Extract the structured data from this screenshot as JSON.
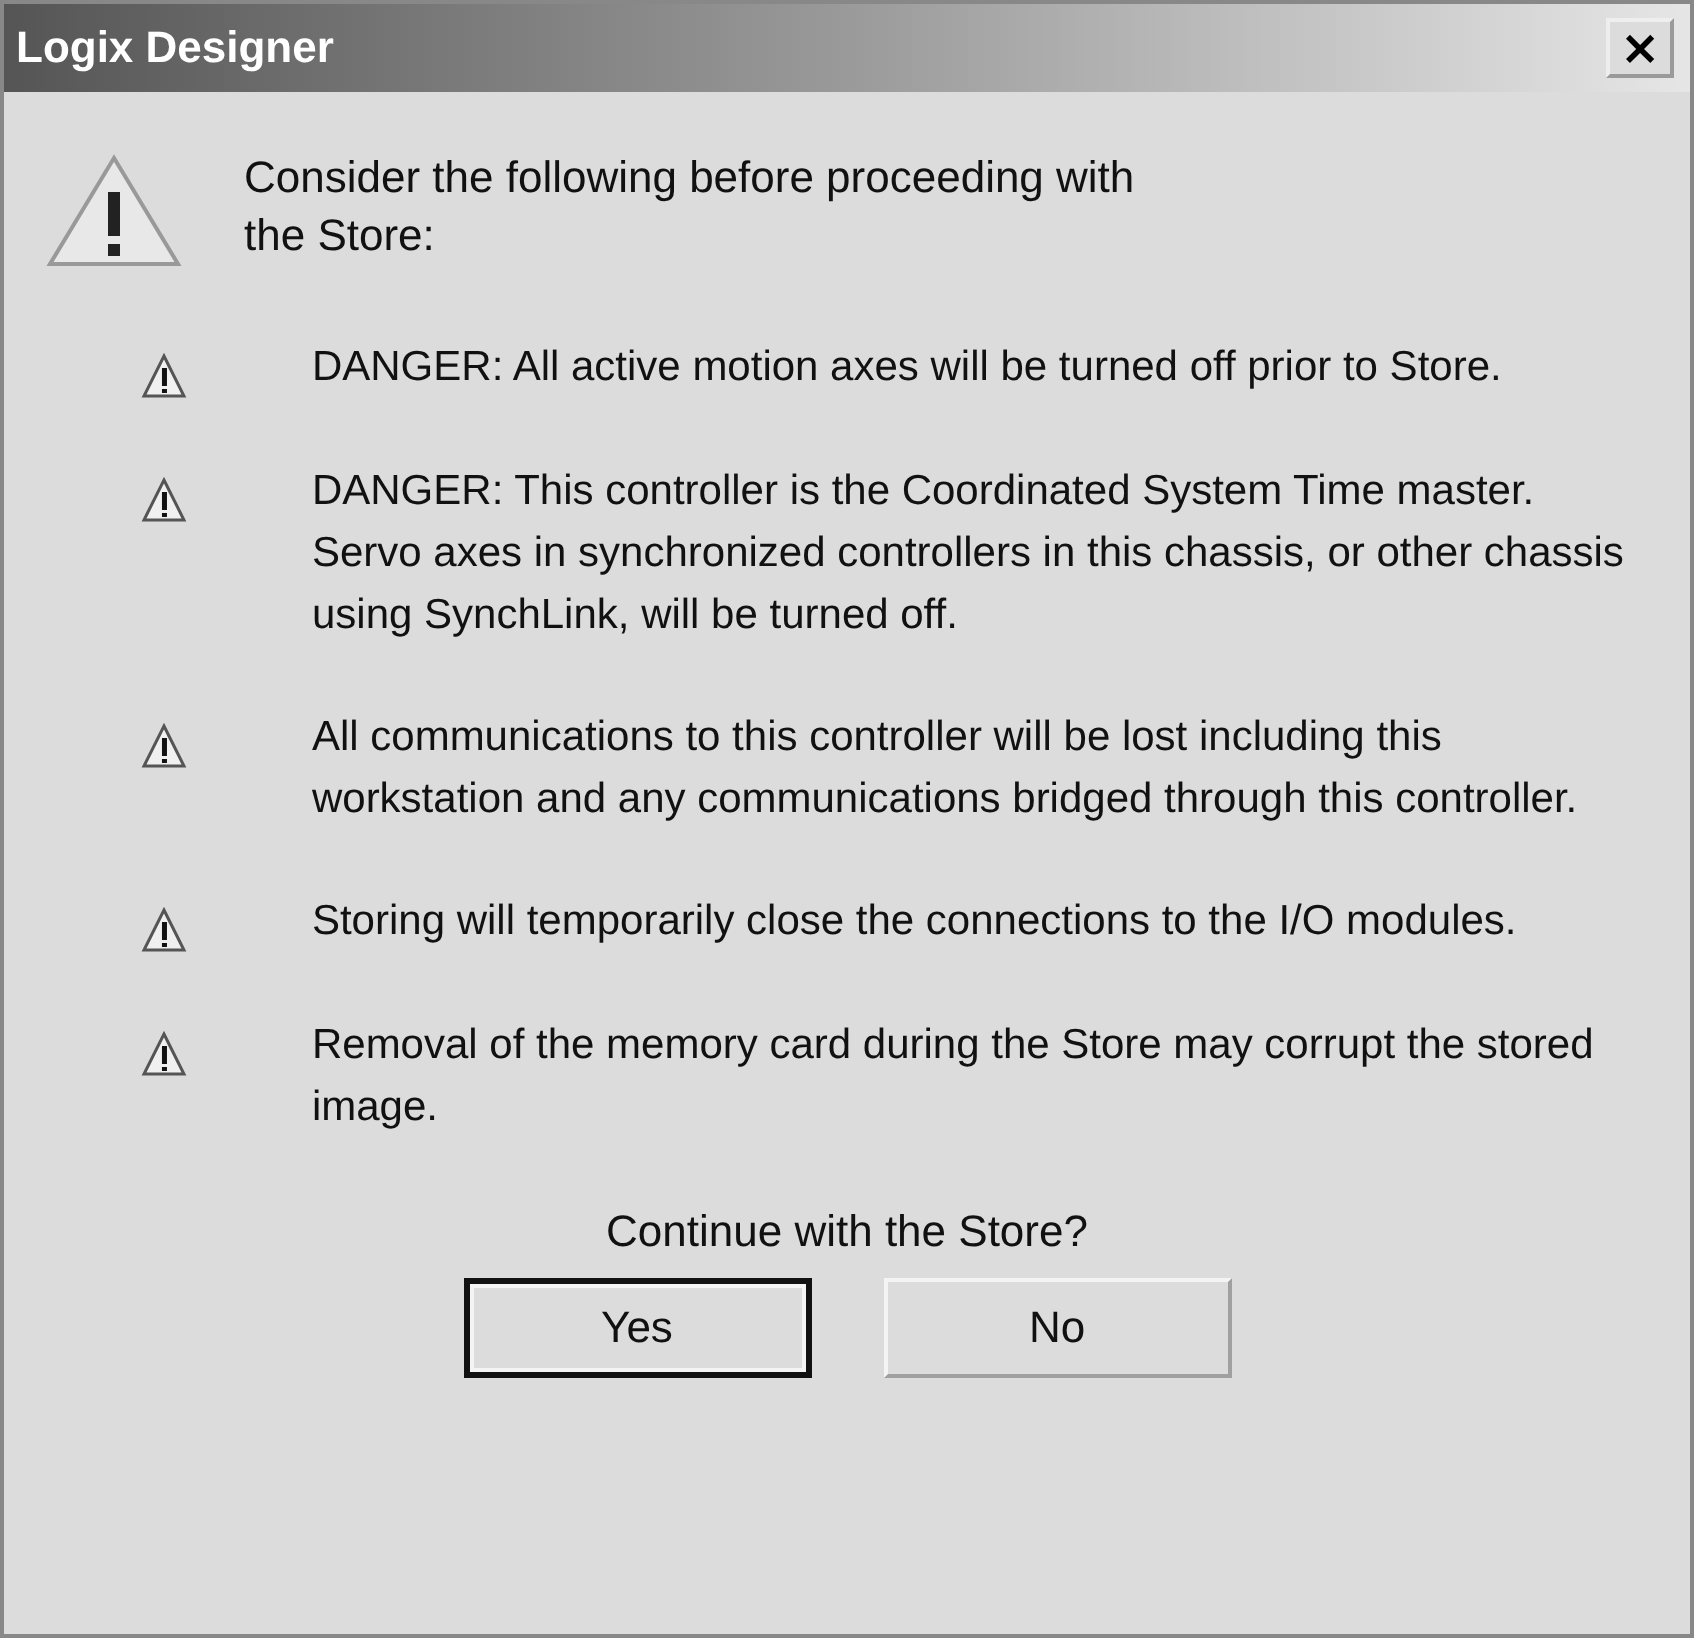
{
  "window": {
    "title": "Logix Designer",
    "close_label": "×"
  },
  "intro": "Consider the following before proceeding with the Store:",
  "warnings": [
    {
      "text": "DANGER: All active motion axes will be turned off prior to Store."
    },
    {
      "text": "DANGER: This controller is the Coordinated System Time master.  Servo axes in synchronized controllers in this chassis, or other chassis using SynchLink, will be turned off."
    },
    {
      "text": "All communications to this controller will be lost including this workstation and any communications bridged through this controller."
    },
    {
      "text": "Storing will temporarily close the connections to the I/O modules."
    },
    {
      "text": "Removal of the memory card during the Store may corrupt the stored image."
    }
  ],
  "question": "Continue with the Store?",
  "buttons": [
    {
      "label": "Yes",
      "default": true
    },
    {
      "label": "No",
      "default": false
    }
  ]
}
